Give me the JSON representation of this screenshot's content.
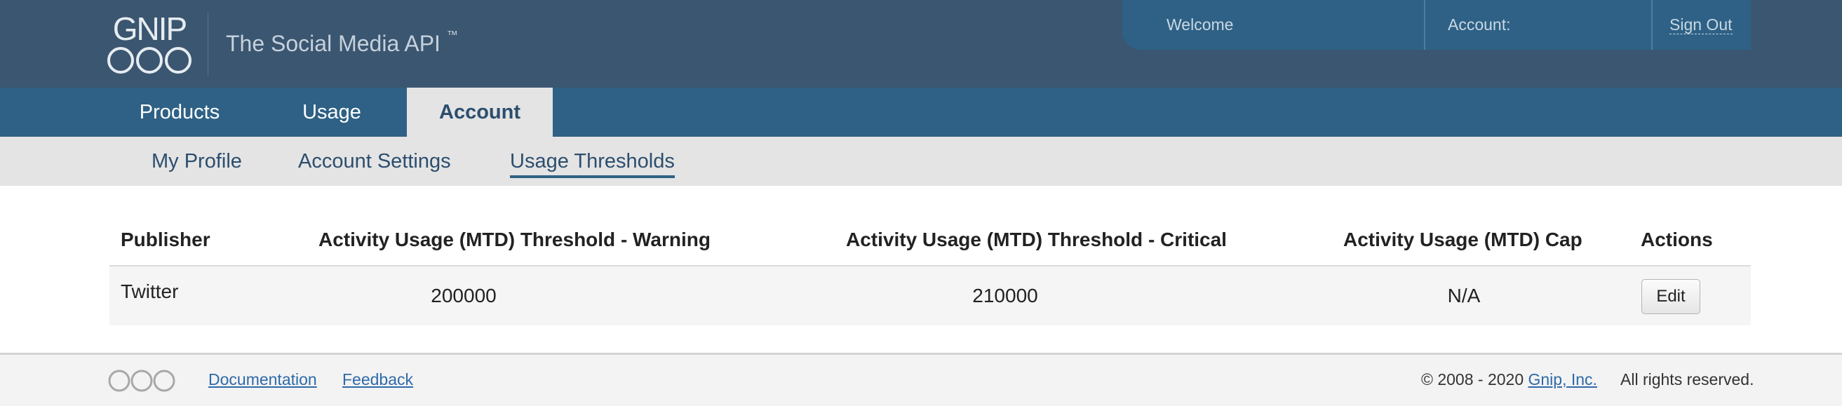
{
  "brand": {
    "logo_text": "GNIP",
    "tagline": "The Social Media API",
    "trademark": "™"
  },
  "userbox": {
    "welcome": "Welcome",
    "account": "Account:",
    "signout": "Sign Out"
  },
  "tabs": [
    {
      "label": "Products",
      "active": false
    },
    {
      "label": "Usage",
      "active": false
    },
    {
      "label": "Account",
      "active": true
    }
  ],
  "subnav": [
    {
      "label": "My Profile",
      "active": false
    },
    {
      "label": "Account Settings",
      "active": false
    },
    {
      "label": "Usage Thresholds",
      "active": true
    }
  ],
  "table": {
    "headers": [
      "Publisher",
      "Activity Usage (MTD) Threshold - Warning",
      "Activity Usage (MTD) Threshold - Critical",
      "Activity Usage (MTD) Cap",
      "Actions"
    ],
    "rows": [
      {
        "publisher": "Twitter",
        "warning": "200000",
        "critical": "210000",
        "cap": "N/A",
        "action": "Edit"
      }
    ]
  },
  "footer": {
    "links": [
      "Documentation",
      "Feedback"
    ],
    "copyright_prefix": "© 2008 - 2020",
    "company": "Gnip, Inc.",
    "rights": "All rights reserved."
  },
  "colors": {
    "header_bg": "#3b5670",
    "tabbar_bg": "#2e6185",
    "subnav_bg": "#e4e4e4",
    "link": "#2e6aa8"
  }
}
